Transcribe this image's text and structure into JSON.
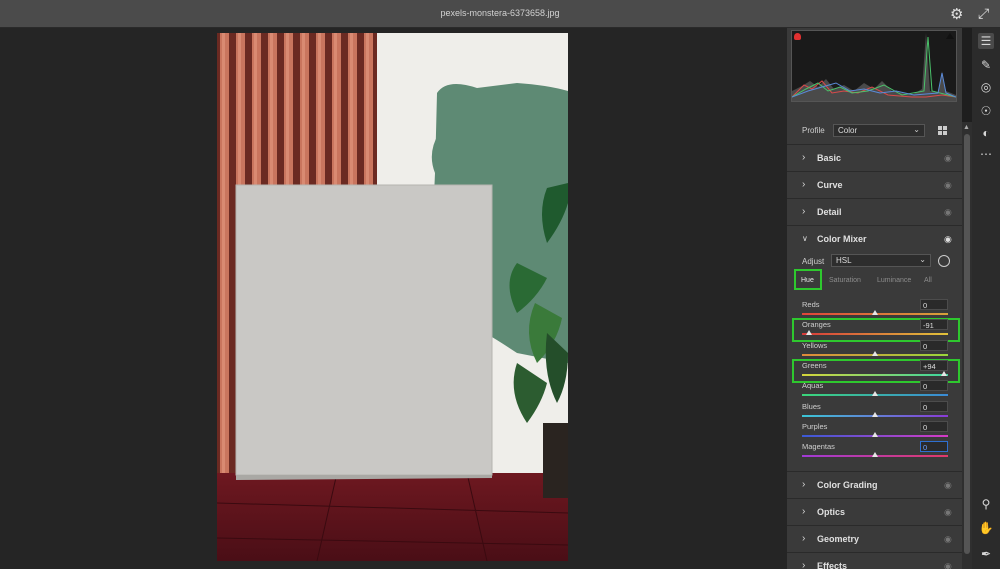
{
  "window": {
    "title": "pexels-monstera-6373658.jpg"
  },
  "icons": {
    "settings": "gear-icon",
    "fullscreen": "expand-icon",
    "warning": "clipping-warning-icon"
  },
  "profile": {
    "label": "Profile",
    "value": "Color"
  },
  "sections_top": [
    {
      "label": "Basic"
    },
    {
      "label": "Curve"
    },
    {
      "label": "Detail"
    }
  ],
  "color_mixer": {
    "title": "Color Mixer",
    "adjust_label": "Adjust",
    "adjust_value": "HSL",
    "tabs": [
      "Hue",
      "Saturation",
      "Luminance",
      "All"
    ],
    "active_tab": "Hue",
    "sliders": [
      {
        "label": "Reds",
        "value": "0",
        "num": 0,
        "colors": [
          "#e0443a",
          "#d6a23a"
        ]
      },
      {
        "label": "Oranges",
        "value": "-91",
        "num": -91,
        "colors": [
          "#d83a3a",
          "#e0c23a"
        ]
      },
      {
        "label": "Yellows",
        "value": "0",
        "num": 0,
        "colors": [
          "#e08a3a",
          "#9ad63a"
        ]
      },
      {
        "label": "Greens",
        "value": "+94",
        "num": 94,
        "colors": [
          "#d6d63a",
          "#3ad6a0"
        ]
      },
      {
        "label": "Aquas",
        "value": "0",
        "num": 0,
        "colors": [
          "#3ad67a",
          "#3a8ad6"
        ]
      },
      {
        "label": "Blues",
        "value": "0",
        "num": 0,
        "colors": [
          "#3ac6d6",
          "#8a3ad6"
        ]
      },
      {
        "label": "Purples",
        "value": "0",
        "num": 0,
        "colors": [
          "#3a5ad6",
          "#d63ac6"
        ]
      },
      {
        "label": "Magentas",
        "value": "0",
        "num": 0,
        "colors": [
          "#a03ad6",
          "#e03a6a"
        ]
      }
    ]
  },
  "sections_bottom": [
    {
      "label": "Color Grading"
    },
    {
      "label": "Optics"
    },
    {
      "label": "Geometry"
    },
    {
      "label": "Effects"
    }
  ],
  "tools": [
    "edit-sliders-icon",
    "healing-brush-icon",
    "masking-icon",
    "red-eye-icon",
    "presets-icon",
    "more-icon",
    "zoom-icon",
    "hand-icon",
    "color-sampler-icon"
  ],
  "accent": {
    "highlight": "#2ec82e",
    "focus": "#2f6fcf"
  }
}
